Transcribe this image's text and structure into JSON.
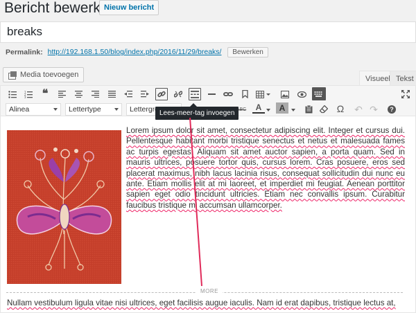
{
  "header": {
    "title": "Bericht bewerken",
    "new_post_label": "Nieuw bericht"
  },
  "post": {
    "title_value": "breaks"
  },
  "permalink": {
    "label": "Permalink:",
    "url": "http://192.168.1.50/blog/index.php/2016/11/29/breaks/",
    "edit_label": "Bewerken"
  },
  "media": {
    "add_label": "Media toevoegen"
  },
  "editor_tabs": {
    "visual": "Visueel",
    "text": "Tekst"
  },
  "toolbar": {
    "paragraph_select": "Alinea",
    "font_family_select": "Lettertype",
    "font_size_select": "Lettergrootte",
    "tooltip": "Lees-meer-tag invoegen",
    "strike_label": "ABC",
    "text_color_label": "A",
    "bg_color_label": "A",
    "omega_label": "Ω",
    "help_label": "?"
  },
  "content": {
    "paragraph_1": "Lorem ipsum dolor sit amet, consectetur adipiscing elit. Integer et cursus dui. Pellentesque habitant morbi tristique senectus et netus et malesuada fames ac turpis egestas. Aliquam sit amet auctor sapien, a porta quam. Sed in mauris ultrices, posuere tortor quis, cursus lorem. Cras posuere, eros sed placerat maximus, nibh lacus lacinia risus, consequat sollicitudin dui nunc eu ante. Etiam mollis elit at mi laoreet, et imperdiet mi feugiat. Aenean porttitor sapien eget odio tincidunt ultricies. Etiam nec convallis ipsum. Curabitur faucibus tristique mi accumsan ullamcorper.",
    "more_label": "MORE",
    "paragraph_2": "Nullam vestibulum ligula vitae nisi ultrices, eget facilisis augue iaculis. Nam id erat dapibus, tristique lectus at,"
  },
  "colors": {
    "accent": "#0073aa",
    "pointer_line": "#e02b5a",
    "image_bg": "#c9412c"
  }
}
